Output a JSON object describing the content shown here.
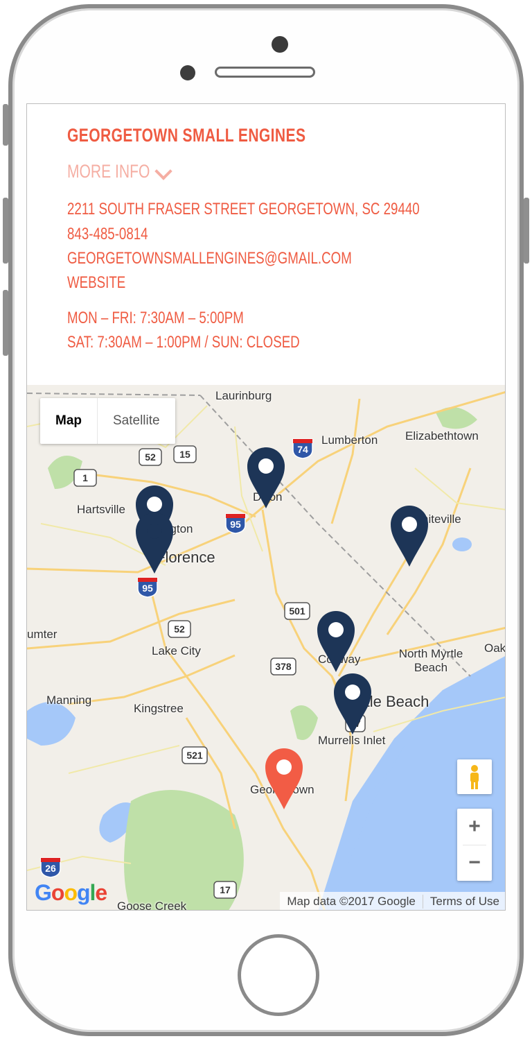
{
  "store": {
    "name": "GEORGETOWN SMALL ENGINES",
    "more_info_label": "MORE INFO",
    "address": "2211 SOUTH FRASER STREET GEORGETOWN, SC 29440",
    "phone": "843-485-0814",
    "email": "GEORGETOWNSMALLENGINES@GMAIL.COM",
    "website_label": "WEBSITE",
    "hours_weekday": "MON – FRI: 7:30AM – 5:00PM",
    "hours_weekend": "SAT: 7:30AM – 1:00PM / SUN: CLOSED"
  },
  "map": {
    "type_controls": {
      "map_label": "Map",
      "satellite_label": "Satellite",
      "selected": "Map"
    },
    "zoom": {
      "in_label": "+",
      "out_label": "−"
    },
    "attribution": {
      "data_label": "Map data ©2017 Google",
      "terms_label": "Terms of Use"
    },
    "logo_text": "Google",
    "places": [
      "Laurinburg",
      "Lumberton",
      "Elizabethtown",
      "Hartsville",
      "Darlington",
      "Florence",
      "Dillon",
      "Whiteville",
      "umter",
      "Lake City",
      "Conway",
      "North Myrtle Beach",
      "Oak",
      "Manning",
      "Kingstree",
      "Myrtle Beach",
      "Murrells Inlet",
      "Georgetown",
      "Goose Creek"
    ],
    "shields": [
      "52",
      "15",
      "1",
      "74",
      "95",
      "95",
      "501",
      "52",
      "378",
      "521",
      "26",
      "17",
      "17"
    ],
    "markers": [
      {
        "name": "Dillon",
        "color": "#1d3557",
        "selected": false
      },
      {
        "name": "Darlington",
        "color": "#1d3557",
        "selected": false
      },
      {
        "name": "Florence",
        "color": "#1d3557",
        "selected": false
      },
      {
        "name": "Whiteville",
        "color": "#1d3557",
        "selected": false
      },
      {
        "name": "Conway",
        "color": "#1d3557",
        "selected": false
      },
      {
        "name": "Myrtle Beach",
        "color": "#1d3557",
        "selected": false
      },
      {
        "name": "Georgetown",
        "color": "#f25c45",
        "selected": true
      }
    ]
  },
  "colors": {
    "accent": "#ef5b42",
    "accent_light": "#f5aea3",
    "marker": "#1d3557",
    "marker_selected": "#f25c45",
    "water": "#a5c8f9",
    "park": "#bfe0a8"
  }
}
